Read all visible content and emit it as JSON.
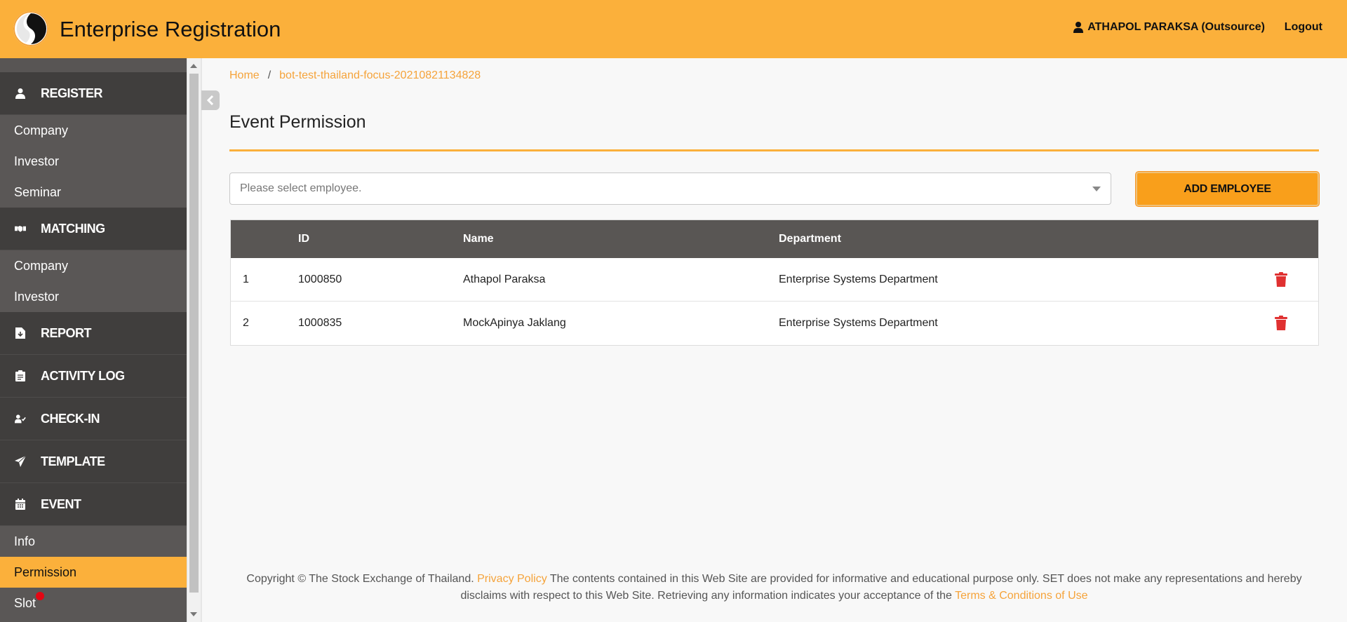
{
  "header": {
    "app_title": "Enterprise Registration",
    "user_name": "ATHAPOL PARAKSA (Outsource)",
    "logout_label": "Logout"
  },
  "colors": {
    "accent": "#fbb03b",
    "sidebar": "#5a5756",
    "sidebar_section": "#403e3d",
    "danger": "#e03131"
  },
  "sidebar": {
    "register": {
      "label": "REGISTER",
      "icon": "user-icon",
      "items": [
        "Company",
        "Investor",
        "Seminar"
      ]
    },
    "matching": {
      "label": "MATCHING",
      "icon": "handshake-icon",
      "items": [
        "Company",
        "Investor"
      ]
    },
    "report": {
      "label": "REPORT",
      "icon": "file-icon"
    },
    "activity_log": {
      "label": "ACTIVITY LOG",
      "icon": "clipboard-icon"
    },
    "check_in": {
      "label": "CHECK-IN",
      "icon": "user-check-icon"
    },
    "template": {
      "label": "TEMPLATE",
      "icon": "paper-plane-icon"
    },
    "event": {
      "label": "EVENT",
      "icon": "calendar-icon",
      "items": [
        "Info",
        "Permission",
        "Slot"
      ],
      "active_item": "Permission"
    }
  },
  "breadcrumb": {
    "home": "Home",
    "separator": "/",
    "current": "bot-test-thailand-focus-20210821134828"
  },
  "page": {
    "title": "Event Permission",
    "select_placeholder": "Please select employee.",
    "add_button": "ADD EMPLOYEE"
  },
  "table": {
    "headers": {
      "no": "",
      "id": "ID",
      "name": "Name",
      "department": "Department"
    },
    "rows": [
      {
        "no": "1",
        "id": "1000850",
        "name": "Athapol Paraksa",
        "department": "Enterprise Systems Department"
      },
      {
        "no": "2",
        "id": "1000835",
        "name": "MockApinya Jaklang",
        "department": "Enterprise Systems Department"
      }
    ]
  },
  "footer": {
    "text1": "Copyright © The Stock Exchange of Thailand. ",
    "privacy_link": "Privacy Policy",
    "text2": " The contents contained in this Web Site are provided for informative and educational purpose only. SET does not make any representations and hereby disclaims with respect to this Web Site. Retrieving any information indicates your acceptance of the ",
    "terms_link": "Terms & Conditions of Use"
  }
}
